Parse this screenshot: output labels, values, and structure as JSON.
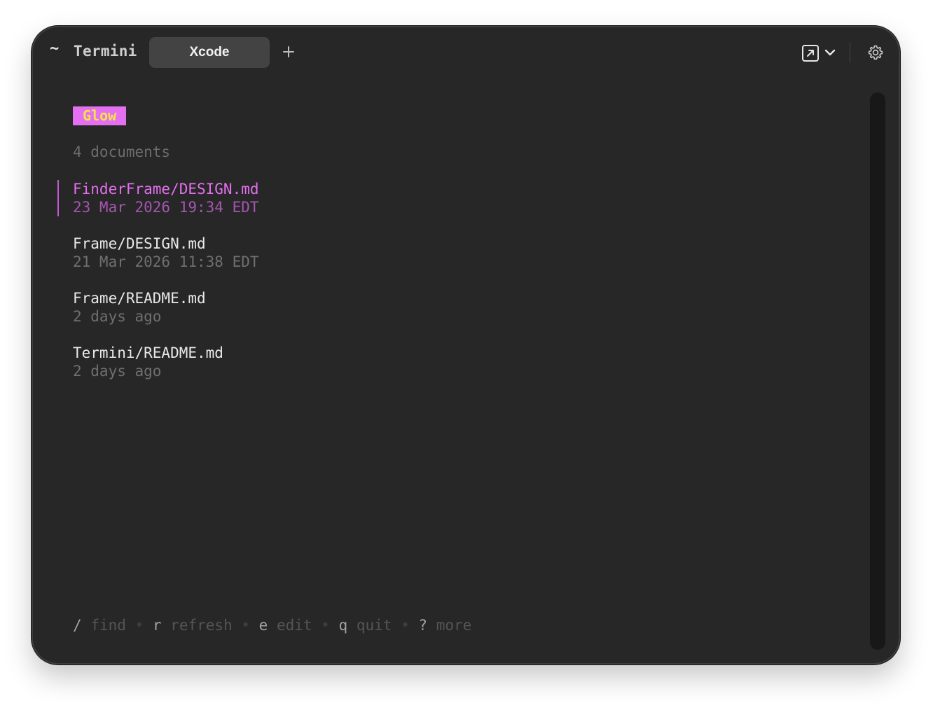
{
  "app": {
    "mark": "~",
    "name": "Termini"
  },
  "tabs": [
    {
      "label": "Xcode"
    }
  ],
  "toolbar": {
    "add_tab_icon": "plus-icon",
    "open_icon": "open-external-icon",
    "menu_icon": "chevron-down-icon",
    "settings_icon": "gear-icon"
  },
  "glow": {
    "badge": "Glow",
    "count": "4 documents",
    "colors": {
      "badge_bg": "#e46ff0",
      "badge_fg": "#f5e447",
      "selected": "#e56ff2"
    },
    "documents": [
      {
        "title": "FinderFrame/DESIGN.md",
        "meta": "23 Mar 2026 19:34 EDT",
        "selected": true
      },
      {
        "title": "Frame/DESIGN.md",
        "meta": "21 Mar 2026 11:38 EDT",
        "selected": false
      },
      {
        "title": "Frame/README.md",
        "meta": "2 days ago",
        "selected": false
      },
      {
        "title": "Termini/README.md",
        "meta": "2 days ago",
        "selected": false
      }
    ],
    "help": [
      {
        "key": "/",
        "label": "find"
      },
      {
        "key": "r",
        "label": "refresh"
      },
      {
        "key": "e",
        "label": "edit"
      },
      {
        "key": "q",
        "label": "quit"
      },
      {
        "key": "?",
        "label": "more"
      }
    ],
    "help_separator": "•"
  }
}
